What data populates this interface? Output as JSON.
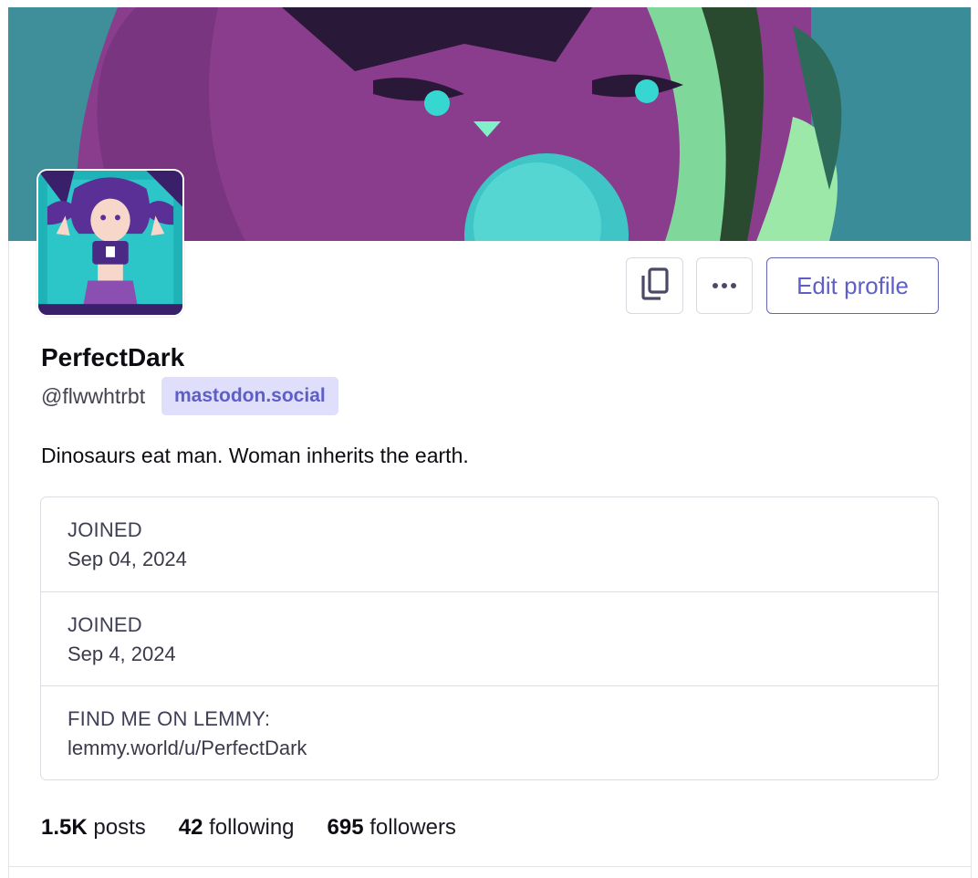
{
  "profile": {
    "display_name": "PerfectDark",
    "handle": "@flwwhtrbt",
    "domain": "mastodon.social",
    "bio": "Dinosaurs eat man. Woman inherits the earth."
  },
  "actions": {
    "copy_icon": "copy-icon",
    "more_icon": "more-horizontal-icon",
    "edit_label": "Edit profile"
  },
  "fields": [
    {
      "label": "JOINED",
      "value": "Sep 04, 2024"
    },
    {
      "label": "JOINED",
      "value": "Sep 4, 2024"
    },
    {
      "label": "FIND ME ON LEMMY:",
      "value": "lemmy.world/u/PerfectDark"
    }
  ],
  "stats": {
    "posts_count": "1.5K",
    "posts_label": "posts",
    "following_count": "42",
    "following_label": "following",
    "followers_count": "695",
    "followers_label": "followers"
  },
  "colors": {
    "accent": "#5f5fc9",
    "badge_bg": "#dfdffb",
    "banner_teal": "#3f8f9b",
    "banner_purple": "#8b3f8f"
  }
}
